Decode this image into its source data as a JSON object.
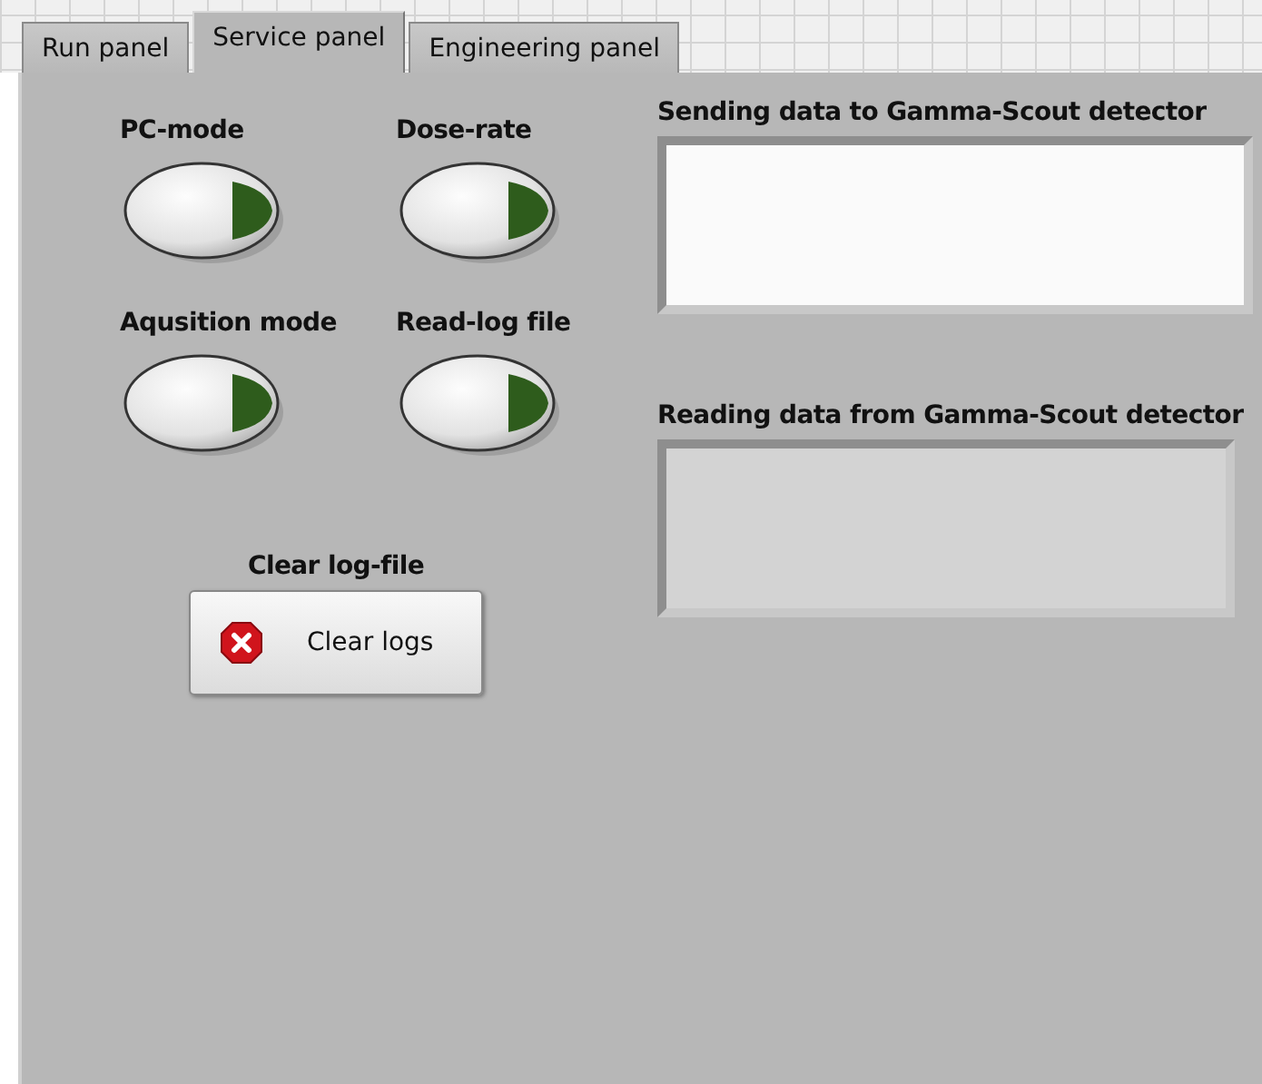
{
  "tabs": [
    {
      "label": "Run panel",
      "selected": false
    },
    {
      "label": "Service panel",
      "selected": true
    },
    {
      "label": "Engineering panel",
      "selected": false
    }
  ],
  "switches": [
    {
      "label": "PC-mode",
      "on": false
    },
    {
      "label": "Dose-rate",
      "on": false
    },
    {
      "label": "Aqusition mode",
      "on": false
    },
    {
      "label": "Read-log file",
      "on": false
    }
  ],
  "clear": {
    "label": "Clear log-file",
    "button": "Clear logs"
  },
  "text_boxes": [
    {
      "label": "Sending data to Gamma-Scout detector",
      "disabled": false
    },
    {
      "label": "Reading data from Gamma-Scout detector",
      "disabled": true
    }
  ]
}
